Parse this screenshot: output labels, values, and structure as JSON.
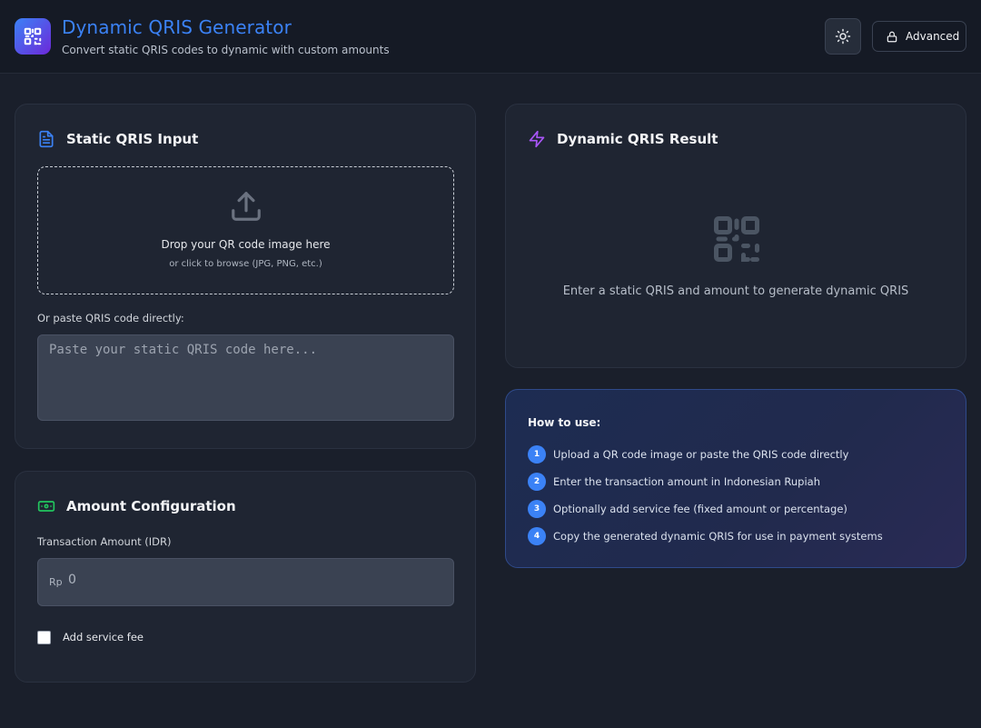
{
  "header": {
    "title": "Dynamic QRIS Generator",
    "subtitle": "Convert static QRIS codes to dynamic with custom amounts",
    "advanced_label": "Advanced",
    "icons": {
      "logo": "qr-code-icon",
      "theme": "sun-icon",
      "advanced": "lock-icon"
    },
    "accent_color": "#3b82f6"
  },
  "static_input": {
    "title": "Static QRIS Input",
    "dropzone_main": "Drop your QR code image here",
    "dropzone_sub": "or click to browse (JPG, PNG, etc.)",
    "paste_label": "Or paste QRIS code directly:",
    "paste_placeholder": "Paste your static QRIS code here...",
    "paste_value": ""
  },
  "amount_config": {
    "title": "Amount Configuration",
    "amount_label": "Transaction Amount (IDR)",
    "currency_prefix": "Rp",
    "amount_placeholder": "0",
    "service_fee_label": "Add service fee",
    "service_fee_checked": false
  },
  "result": {
    "title": "Dynamic QRIS Result",
    "empty_message": "Enter a static QRIS and amount to generate dynamic QRIS"
  },
  "how_to": {
    "title": "How to use:",
    "steps": [
      {
        "num": "1",
        "text": "Upload a QR code image or paste the QRIS code directly"
      },
      {
        "num": "2",
        "text": "Enter the transaction amount in Indonesian Rupiah"
      },
      {
        "num": "3",
        "text": "Optionally add service fee (fixed amount or percentage)"
      },
      {
        "num": "4",
        "text": "Copy the generated dynamic QRIS for use in payment systems"
      }
    ]
  }
}
